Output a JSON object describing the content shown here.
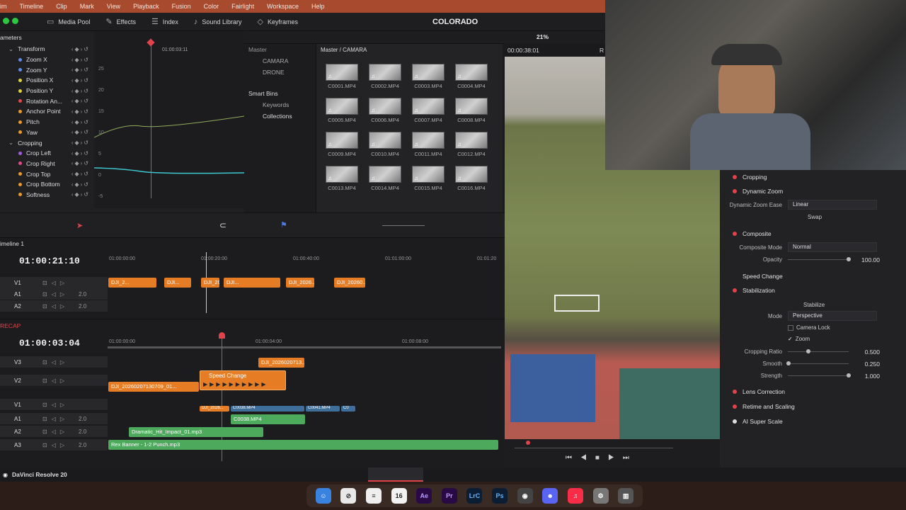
{
  "menu": [
    "im",
    "Timeline",
    "Clip",
    "Mark",
    "View",
    "Playback",
    "Fusion",
    "Color",
    "Fairlight",
    "Workspace",
    "Help"
  ],
  "toolbar": {
    "media_pool": "Media Pool",
    "effects": "Effects",
    "index": "Index",
    "sound_library": "Sound Library",
    "keyframes": "Keyframes",
    "project_title": "COLORADO",
    "zoom": "21%"
  },
  "keyframes": {
    "header": "ameters",
    "timecode": "01:00:03:11",
    "params": [
      {
        "label": "Transform",
        "group": true
      },
      {
        "label": "Zoom X",
        "color": "#5b8de0"
      },
      {
        "label": "Zoom Y",
        "color": "#5b8de0"
      },
      {
        "label": "Position X",
        "color": "#e2d13c"
      },
      {
        "label": "Position Y",
        "color": "#e2d13c"
      },
      {
        "label": "Rotation An...",
        "color": "#e04a4a"
      },
      {
        "label": "Anchor Point",
        "color": "#e89b2d"
      },
      {
        "label": "Pitch",
        "color": "#e89b2d"
      },
      {
        "label": "Yaw",
        "color": "#e89b2d"
      },
      {
        "label": "Cropping",
        "group": true
      },
      {
        "label": "Crop Left",
        "color": "#a15be0"
      },
      {
        "label": "Crop Right",
        "color": "#e04a8e"
      },
      {
        "label": "Crop Top",
        "color": "#e89b2d"
      },
      {
        "label": "Crop Bottom",
        "color": "#e89b2d"
      },
      {
        "label": "Softness",
        "color": "#e89b2d"
      }
    ],
    "axis": [
      "25",
      "20",
      "15",
      "10",
      "5",
      "0",
      "-5"
    ]
  },
  "bins": {
    "master": "Master",
    "items": [
      "CAMARA",
      "DRONE"
    ],
    "smart_bins": "Smart Bins",
    "keywords": "Keywords",
    "collections": "Collections"
  },
  "media_grid": {
    "path": "Master / CAMARA",
    "clips": [
      "C0001.MP4",
      "C0002.MP4",
      "C0003.MP4",
      "C0004.MP4",
      "C0005.MP4",
      "C0006.MP4",
      "C0007.MP4",
      "C0008.MP4",
      "C0009.MP4",
      "C0010.MP4",
      "C0011.MP4",
      "C0012.MP4",
      "C0013.MP4",
      "C0014.MP4",
      "C0015.MP4",
      "C0016.MP4"
    ]
  },
  "viewer": {
    "timecode": "00:00:38:01",
    "marker": "R"
  },
  "inspector": {
    "cropping": "Cropping",
    "dynamic_zoom": "Dynamic Zoom",
    "dz_ease_label": "Dynamic Zoom Ease",
    "dz_ease_value": "Linear",
    "swap": "Swap",
    "composite": "Composite",
    "composite_mode_label": "Composite Mode",
    "composite_mode_value": "Normal",
    "opacity_label": "Opacity",
    "opacity_value": "100.00",
    "speed_change": "Speed Change",
    "stabilization": "Stabilization",
    "stabilize": "Stabilize",
    "mode_label": "Mode",
    "mode_value": "Perspective",
    "camera_lock": "Camera Lock",
    "zoom": "Zoom",
    "cropping_ratio_label": "Cropping Ratio",
    "cropping_ratio_value": "0.500",
    "smooth_label": "Smooth",
    "smooth_value": "0.250",
    "strength_label": "Strength",
    "strength_value": "1.000",
    "lens_correction": "Lens Correction",
    "retime": "Retime and Scaling",
    "ai_super_scale": "AI Super Scale"
  },
  "timeline1": {
    "name": "imeline 1",
    "timecode": "01:00:21:10",
    "ruler": [
      "01:00:00:00",
      "01:00:20:00",
      "01:00:40:00",
      "01:01:00:00",
      "01:01:20"
    ],
    "tracks": [
      {
        "id": "V1",
        "value": ""
      },
      {
        "id": "A1",
        "value": "2.0"
      },
      {
        "id": "A2",
        "value": "2.0"
      }
    ],
    "clips": [
      "DJI_2...",
      "DJI...",
      "DJI_2026...",
      "DJI...",
      "DJI_2026...",
      "DJI_20260..."
    ]
  },
  "timeline2": {
    "name": "RECAP",
    "timecode": "01:00:03:04",
    "ruler": [
      "01:00:00:00",
      "01:00:04:00",
      "01:00:08:00"
    ],
    "tracks": [
      {
        "id": "V3",
        "value": ""
      },
      {
        "id": "V2",
        "value": ""
      },
      {
        "id": "V1",
        "value": ""
      },
      {
        "id": "A1",
        "value": "2.0"
      },
      {
        "id": "A2",
        "value": "2.0"
      },
      {
        "id": "A3",
        "value": "2.0"
      }
    ],
    "speed_change_label": "Speed Change",
    "clips": {
      "v3": "DJI_2026020713...",
      "v2": "DJI_20260207130709_01...",
      "v1a": "DJI_2026...",
      "v1b": "C0038.MP4",
      "v1c": "C0041.MP4",
      "v1d": "C0",
      "a1": "C0038.MP4",
      "a2": "Dramatic_Hit_Impact_01.mp3",
      "a3": "Rex Banner - 1-2 Punch.mp3"
    }
  },
  "status": {
    "app": "DaVinci Resolve 20"
  },
  "dock": [
    "Ae",
    "Pr",
    "LrC",
    "Ps",
    "16"
  ]
}
